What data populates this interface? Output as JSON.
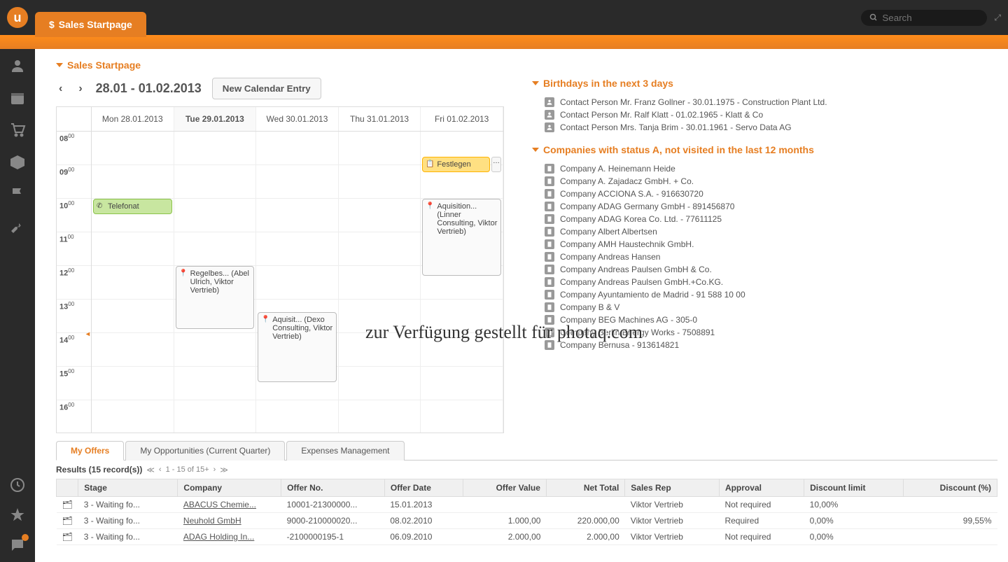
{
  "watermark": "zur Verfügung gestellt für photaq.com",
  "logo_letter": "u",
  "active_tab": "Sales Startpage",
  "search": {
    "placeholder": "Search"
  },
  "page_title": "Sales Startpage",
  "calendar": {
    "prev": "‹",
    "next": "›",
    "range": "28.01 - 01.02.2013",
    "new_entry": "New Calendar Entry",
    "days": [
      {
        "label": "Mon 28.01.2013",
        "today": false
      },
      {
        "label": "Tue 29.01.2013",
        "today": true
      },
      {
        "label": "Wed 30.01.2013",
        "today": false
      },
      {
        "label": "Thu 31.01.2013",
        "today": false
      },
      {
        "label": "Fri 01.02.2013",
        "today": false
      }
    ],
    "times": [
      "08",
      "09",
      "10",
      "11",
      "12",
      "13",
      "14",
      "15",
      "16"
    ],
    "events": {
      "telefonat": "Telefonat",
      "regelbes": "Regelbes... (Abel Ulrich, Viktor Vertrieb)",
      "aquisit1": "Aquisit... (Dexo Consulting, Viktor Vertrieb)",
      "festlegen": "Festlegen",
      "aquisition": "Aquisition... (Linner Consulting, Viktor Vertrieb)"
    }
  },
  "birthdays": {
    "title": "Birthdays in the next 3 days",
    "items": [
      "Contact Person Mr. Franz Gollner - 30.01.1975 - Construction Plant Ltd.",
      "Contact Person Mr. Ralf Klatt - 01.02.1965 - Klatt & Co",
      "Contact Person Mrs. Tanja Brim - 30.01.1961 - Servo Data AG"
    ]
  },
  "companies": {
    "title": "Companies with status A, not visited in the last 12 months",
    "items": [
      "Company A. Heinemann Heide",
      "Company A. Zajadacz GmbH. + Co.",
      "Company ACCIONA S.A. - 916630720",
      "Company ADAG Germany GmbH - 891456870",
      "Company ADAG Korea Co. Ltd. - 77611125",
      "Company Albert Albertsen",
      "Company AMH Haustechnik GmbH.",
      "Company Andreas Hansen",
      "Company Andreas Paulsen GmbH & Co.",
      "Company Andreas Paulsen GmbH.+Co.KG.",
      "Company Ayuntamiento de Madrid - 91 588 10 00",
      "Company B & V",
      "Company BEG Machines AG - 305-0",
      "Company Berlin Energy Works - 7508891",
      "Company Bernusa - 913614821"
    ]
  },
  "bottom_tabs": {
    "t1": "My Offers",
    "t2": "My Opportunities (Current Quarter)",
    "t3": "Expenses Management"
  },
  "results": {
    "label": "Results (15 record(s))",
    "pager": "1 - 15 of 15+",
    "headers": [
      "Stage",
      "Company",
      "Offer No.",
      "Offer Date",
      "Offer Value",
      "Net Total",
      "Sales Rep",
      "Approval",
      "Discount limit",
      "Discount (%)"
    ],
    "rows": [
      {
        "stage": "3 - Waiting fo...",
        "company": "ABACUS Chemie...",
        "offerno": "10001-21300000...",
        "date": "15.01.2013",
        "value": "",
        "net": "",
        "rep": "Viktor Vertrieb",
        "approval": "Not required",
        "limit": "10,00%",
        "discount": ""
      },
      {
        "stage": "3 - Waiting fo...",
        "company": "Neuhold GmbH",
        "offerno": "9000-210000020...",
        "date": "08.02.2010",
        "value": "1.000,00",
        "net": "220.000,00",
        "rep": "Viktor Vertrieb",
        "approval": "Required",
        "limit": "0,00%",
        "discount": "99,55%"
      },
      {
        "stage": "3 - Waiting fo...",
        "company": "ADAG Holding In...",
        "offerno": "-2100000195-1",
        "date": "06.09.2010",
        "value": "2.000,00",
        "net": "2.000,00",
        "rep": "Viktor Vertrieb",
        "approval": "Not required",
        "limit": "0,00%",
        "discount": ""
      }
    ]
  }
}
